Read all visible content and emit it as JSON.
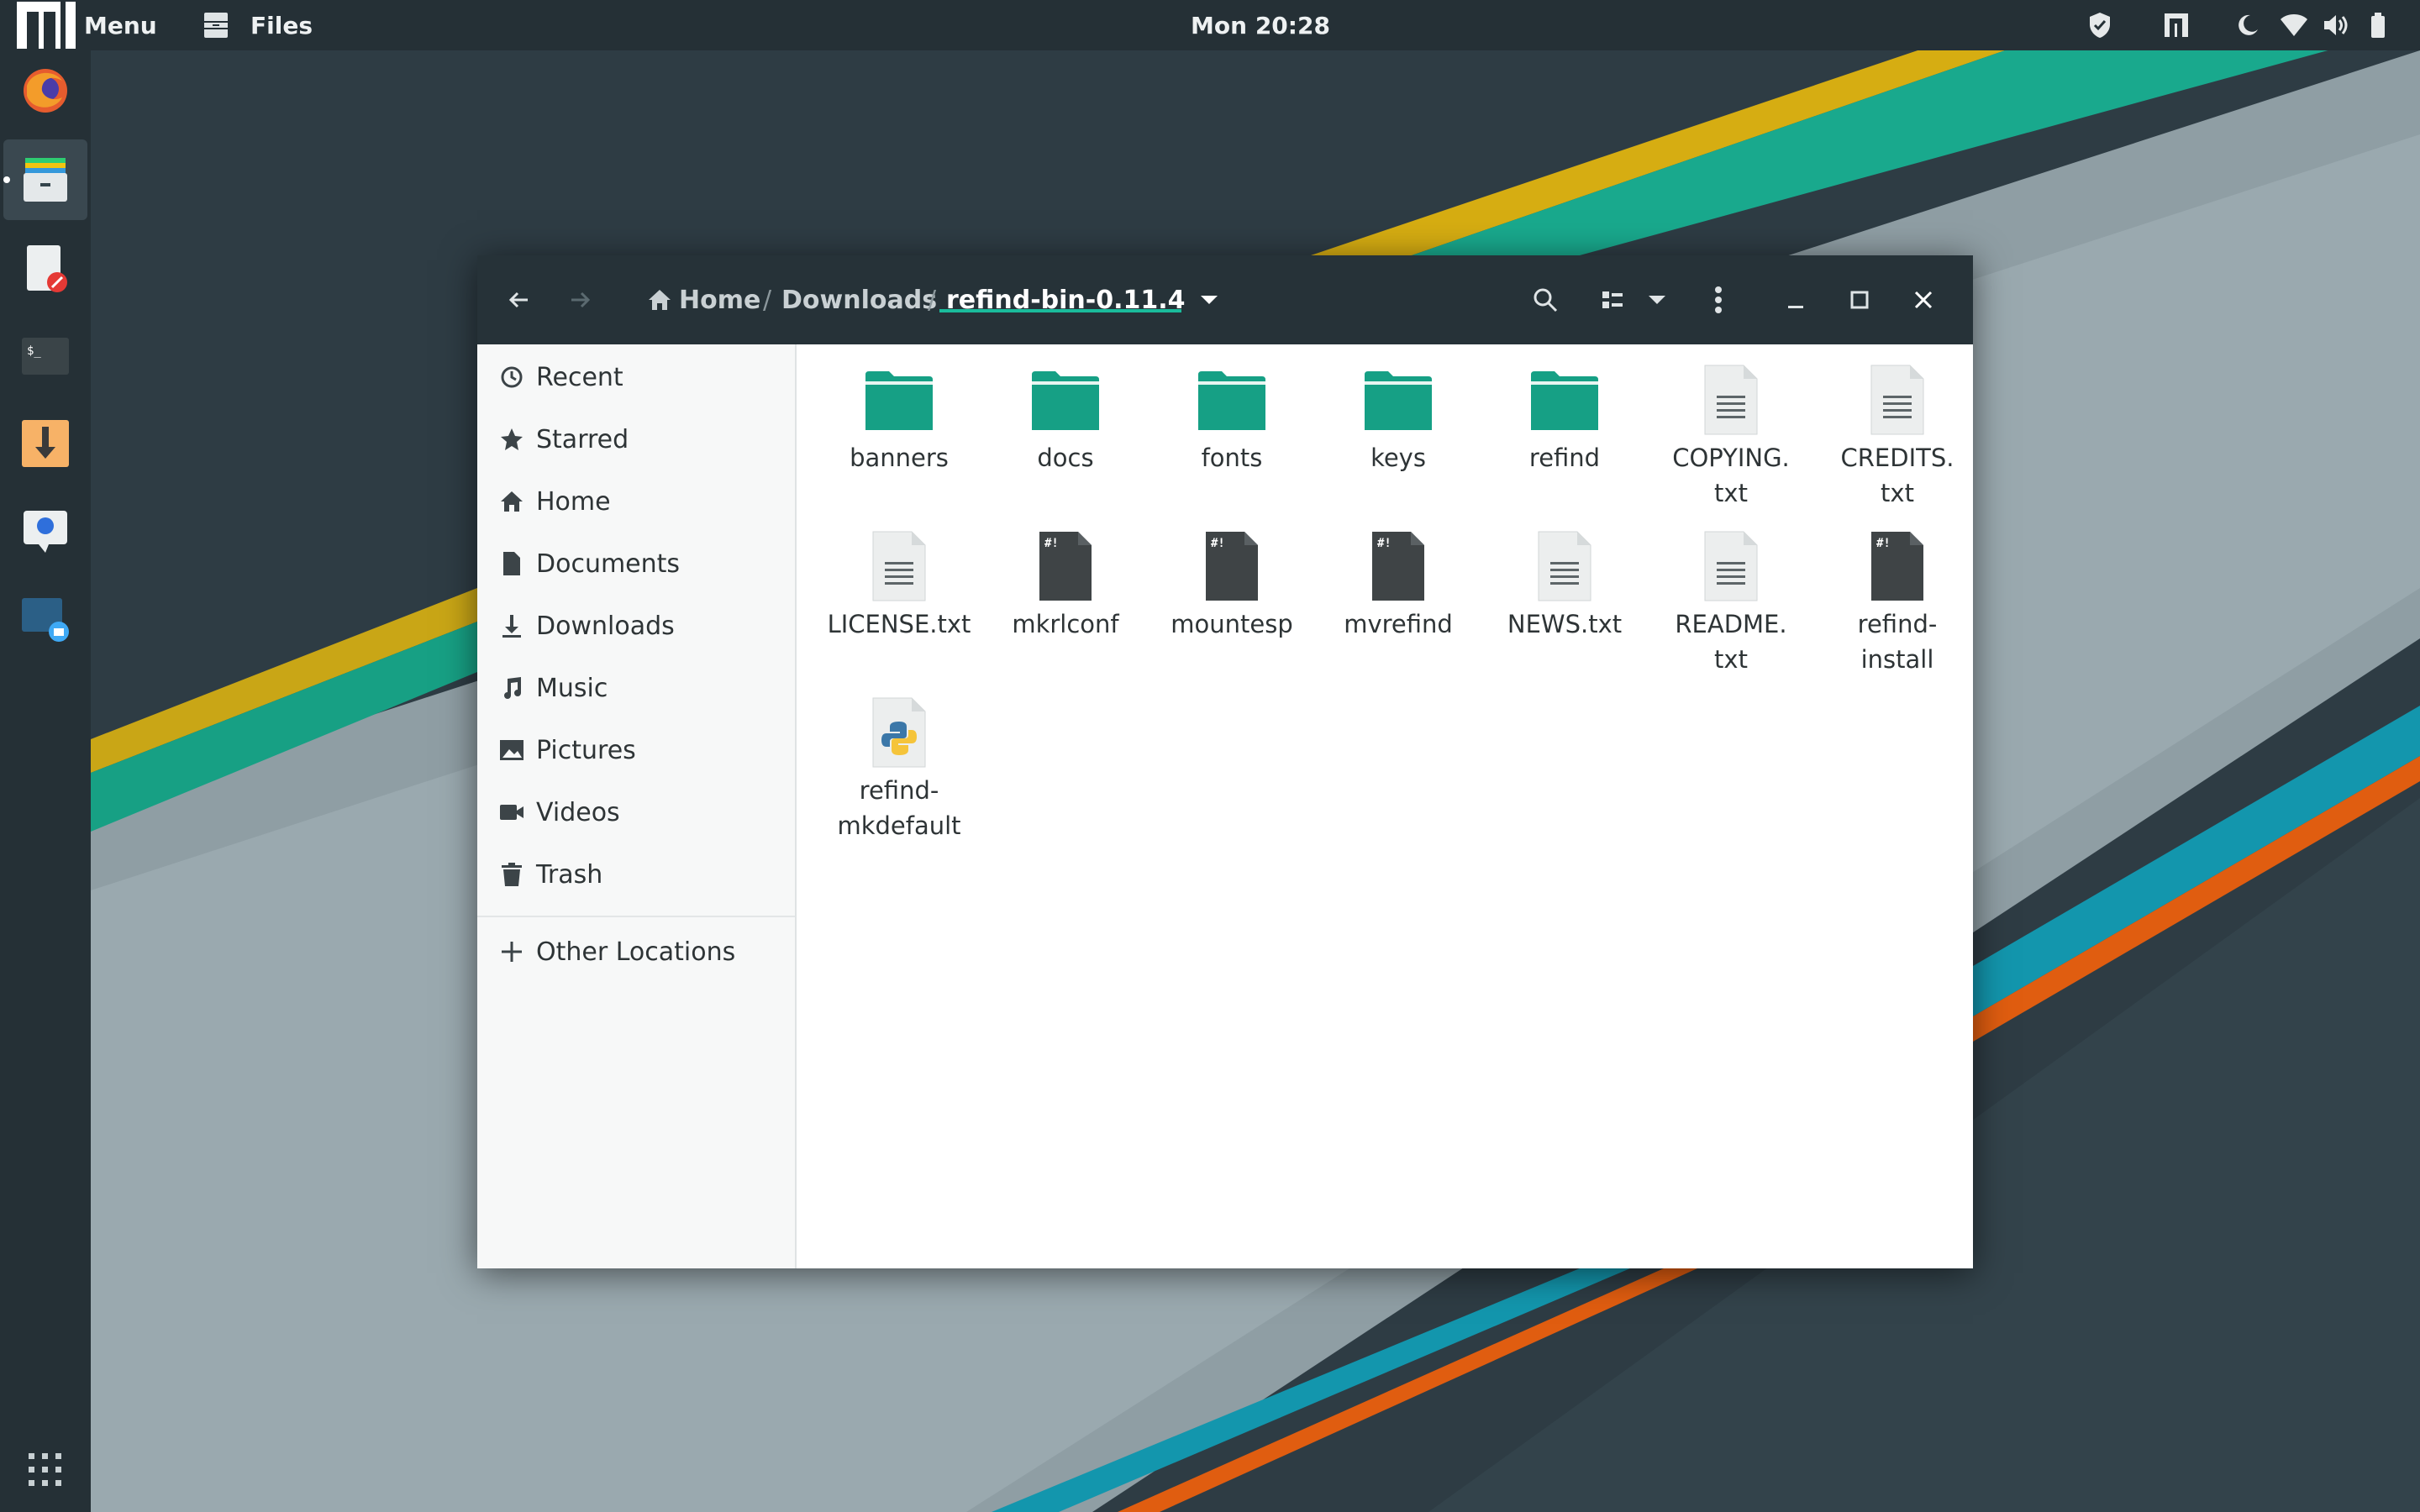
{
  "topbar": {
    "menu_label": "Menu",
    "app_label": "Files",
    "clock": "Mon 20:28",
    "tray_icons": [
      "shield-icon",
      "manjaro-icon",
      "night-light-icon",
      "wifi-icon",
      "volume-icon",
      "battery-icon"
    ]
  },
  "dock": {
    "items": [
      "firefox",
      "files",
      "text-editor",
      "terminal",
      "downloader",
      "chat",
      "screenshot"
    ],
    "apps_grid_icon": "apps-grid-icon"
  },
  "window": {
    "breadcrumb": {
      "home": "Home",
      "sep1": "/",
      "downloads": "Downloads",
      "sep2": "/",
      "current": "refind-bin-0.11.4"
    }
  },
  "sidebar": {
    "items": [
      {
        "label": "Recent",
        "icon": "clock-icon"
      },
      {
        "label": "Starred",
        "icon": "star-icon"
      },
      {
        "label": "Home",
        "icon": "home-icon"
      },
      {
        "label": "Documents",
        "icon": "document-icon"
      },
      {
        "label": "Downloads",
        "icon": "download-icon"
      },
      {
        "label": "Music",
        "icon": "music-icon"
      },
      {
        "label": "Pictures",
        "icon": "picture-icon"
      },
      {
        "label": "Videos",
        "icon": "video-icon"
      },
      {
        "label": "Trash",
        "icon": "trash-icon"
      }
    ],
    "other_locations": "Other Locations"
  },
  "files": [
    {
      "name_l1": "banners",
      "name_l2": "",
      "type": "folder"
    },
    {
      "name_l1": "docs",
      "name_l2": "",
      "type": "folder"
    },
    {
      "name_l1": "fonts",
      "name_l2": "",
      "type": "folder"
    },
    {
      "name_l1": "keys",
      "name_l2": "",
      "type": "folder"
    },
    {
      "name_l1": "refind",
      "name_l2": "",
      "type": "folder"
    },
    {
      "name_l1": "COPYING.",
      "name_l2": "txt",
      "type": "text"
    },
    {
      "name_l1": "CREDITS.",
      "name_l2": "txt",
      "type": "text"
    },
    {
      "name_l1": "LICENSE.txt",
      "name_l2": "",
      "type": "text"
    },
    {
      "name_l1": "mkrlconf",
      "name_l2": "",
      "type": "script"
    },
    {
      "name_l1": "mountesp",
      "name_l2": "",
      "type": "script"
    },
    {
      "name_l1": "mvrefind",
      "name_l2": "",
      "type": "script"
    },
    {
      "name_l1": "NEWS.txt",
      "name_l2": "",
      "type": "text"
    },
    {
      "name_l1": "README.",
      "name_l2": "txt",
      "type": "text"
    },
    {
      "name_l1": "refind-",
      "name_l2": "install",
      "type": "script"
    },
    {
      "name_l1": "refind-",
      "name_l2": "mkdefault",
      "type": "python"
    }
  ],
  "colors": {
    "folder": "#16a085",
    "headerbar": "#263238",
    "accent": "#1abc9c"
  }
}
